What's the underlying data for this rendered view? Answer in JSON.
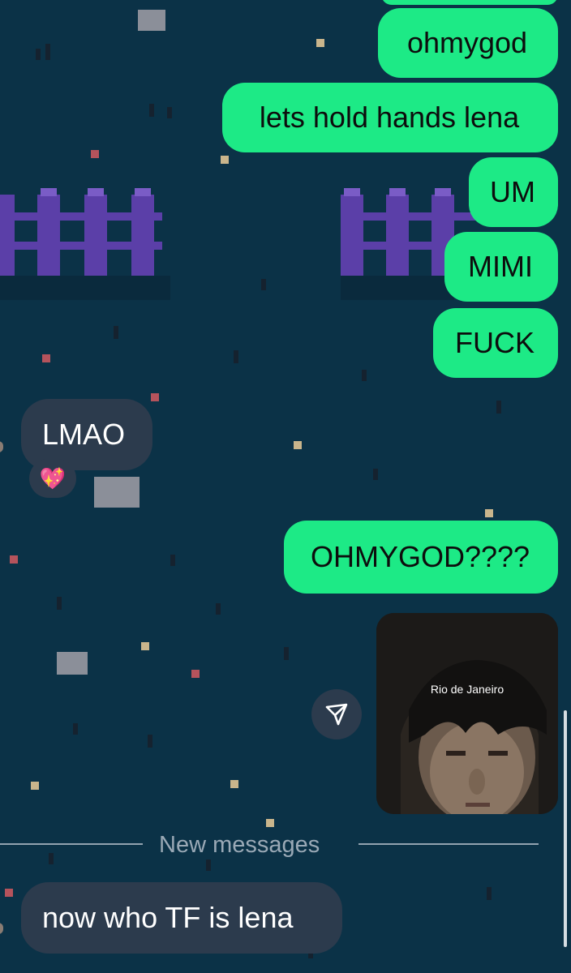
{
  "chat": {
    "background_color": "#0b3247",
    "outgoing_color": "#1dea86",
    "incoming_color": "#2c3b4d",
    "messages": [
      {
        "id": "m1",
        "direction": "outgoing",
        "text": "ohmygod"
      },
      {
        "id": "m2",
        "direction": "outgoing",
        "text": "lets hold hands lena"
      },
      {
        "id": "m3",
        "direction": "outgoing",
        "text": "UM"
      },
      {
        "id": "m4",
        "direction": "outgoing",
        "text": "MIMI"
      },
      {
        "id": "m5",
        "direction": "outgoing",
        "text": "FUCK"
      },
      {
        "id": "m6",
        "direction": "incoming",
        "text": "LMAO",
        "reaction": "💖"
      },
      {
        "id": "m7",
        "direction": "outgoing",
        "text": "OHMYGOD????"
      },
      {
        "id": "m8",
        "direction": "outgoing",
        "type": "shared-media",
        "caption": "Rio de Janeiro"
      },
      {
        "id": "m9",
        "direction": "incoming",
        "text": "now who TF is lena"
      }
    ],
    "new_messages_label": "New messages",
    "share_icon": "send-icon"
  }
}
